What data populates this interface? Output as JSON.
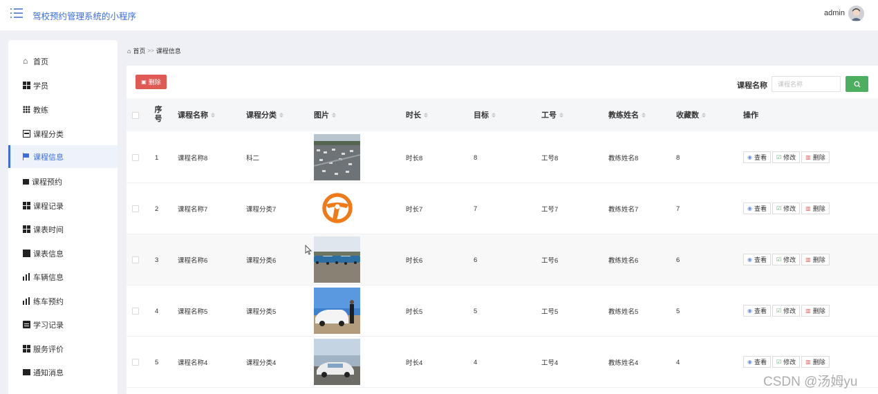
{
  "header": {
    "app_title": "驾校预约管理系统的小程序",
    "user": "admin"
  },
  "sidebar": {
    "items": [
      {
        "label": "首页",
        "icon": "home-icon"
      },
      {
        "label": "学员",
        "icon": "grid-icon"
      },
      {
        "label": "教练",
        "icon": "dots-grid-icon"
      },
      {
        "label": "课程分类",
        "icon": "briefcase-icon"
      },
      {
        "label": "课程信息",
        "icon": "flag-icon",
        "active": true
      },
      {
        "label": "课程预约",
        "icon": "pushpin-icon"
      },
      {
        "label": "课程记录",
        "icon": "grid-icon"
      },
      {
        "label": "课表时间",
        "icon": "grid-icon"
      },
      {
        "label": "课表信息",
        "icon": "area-chart-icon"
      },
      {
        "label": "车辆信息",
        "icon": "bar-chart-icon"
      },
      {
        "label": "练车预约",
        "icon": "bar-chart-icon"
      },
      {
        "label": "学习记录",
        "icon": "document-icon"
      },
      {
        "label": "服务评价",
        "icon": "grid-icon"
      },
      {
        "label": "通知消息",
        "icon": "map-icon"
      }
    ]
  },
  "breadcrumb": {
    "home": "首页",
    "sep": ">>",
    "current": "课程信息"
  },
  "toolbar": {
    "delete_label": "删除",
    "search_label": "课程名称",
    "search_placeholder": "课程名称"
  },
  "table": {
    "columns": [
      "序号",
      "课程名称",
      "课程分类",
      "图片",
      "时长",
      "目标",
      "工号",
      "教练姓名",
      "收藏数",
      "操作"
    ],
    "rows": [
      {
        "index": "1",
        "name": "课程名称8",
        "category": "科二",
        "image": "parking-lot-photo",
        "duration": "时长8",
        "target": "8",
        "job_no": "工号8",
        "coach": "教练姓名8",
        "favorites": "8"
      },
      {
        "index": "2",
        "name": "课程名称7",
        "category": "课程分类7",
        "image": "steering-wheel-icon",
        "duration": "时长7",
        "target": "7",
        "job_no": "工号7",
        "coach": "教练姓名7",
        "favorites": "7"
      },
      {
        "index": "3",
        "name": "课程名称6",
        "category": "课程分类6",
        "image": "cars-row-photo",
        "duration": "时长6",
        "target": "6",
        "job_no": "工号6",
        "coach": "教练姓名6",
        "favorites": "6"
      },
      {
        "index": "4",
        "name": "课程名称5",
        "category": "课程分类5",
        "image": "car-instructor-photo",
        "duration": "时长5",
        "target": "5",
        "job_no": "工号5",
        "coach": "教练姓名5",
        "favorites": "5"
      },
      {
        "index": "5",
        "name": "课程名称4",
        "category": "课程分类4",
        "image": "car-training-photo",
        "duration": "时长4",
        "target": "4",
        "job_no": "工号4",
        "coach": "教练姓名4",
        "favorites": "4"
      }
    ],
    "actions": {
      "view": "查看",
      "edit": "修改",
      "delete": "删除"
    }
  },
  "watermark": "CSDN @汤姆yu",
  "colors": {
    "primary": "#3c6ee0",
    "danger": "#e05a55",
    "success": "#4cae5e",
    "steering_wheel": "#f07a18"
  }
}
